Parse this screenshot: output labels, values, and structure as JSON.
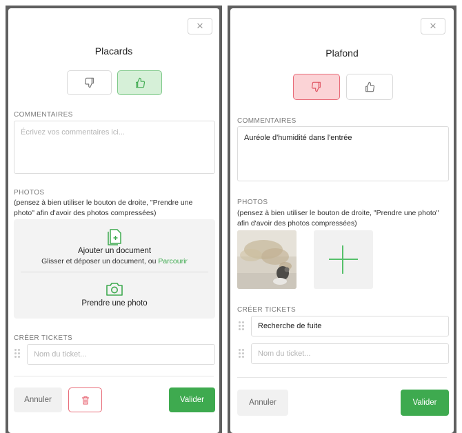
{
  "left": {
    "close_icon": "×",
    "title": "Placards",
    "vote": {
      "down_icon": "thumbs-down-icon",
      "up_icon": "thumbs-up-icon",
      "active": "up"
    },
    "comments_label": "COMMENTAIRES",
    "comments_placeholder": "Écrivez vos commentaires ici...",
    "photos_label": "PHOTOS",
    "photos_hint": "(pensez à bien utiliser le bouton de droite, \"Prendre une photo\" afin d'avoir des photos compressées)",
    "upload": {
      "add_doc_label": "Ajouter un document",
      "drag_text": "Glisser et déposer un document, ou ",
      "browse_link": "Parcourir",
      "take_photo_label": "Prendre une photo"
    },
    "tickets_label": "CRÉER TICKETS",
    "ticket_placeholder": "Nom du ticket...",
    "cancel_label": "Annuler",
    "validate_label": "Valider"
  },
  "right": {
    "close_icon": "×",
    "title": "Plafond",
    "vote": {
      "down_icon": "thumbs-down-icon",
      "up_icon": "thumbs-up-icon",
      "active": "down"
    },
    "comments_label": "COMMENTAIRES",
    "comments_value": "Auréole d'humidité dans l'entrée",
    "photos_label": "PHOTOS",
    "photos_hint": "(pensez à bien utiliser le bouton de droite, \"Prendre une photo\" afin d'avoir des photos compressées)",
    "tickets_label": "CRÉER TICKETS",
    "ticket_value": "Recherche de fuite",
    "ticket_placeholder": "Nom du ticket...",
    "cancel_label": "Annuler",
    "validate_label": "Valider"
  },
  "colors": {
    "accent_green": "#3eaa4f",
    "danger_red": "#e86b78",
    "active_up_bg": "#d6f0d8",
    "active_down_bg": "#fbd3d6"
  }
}
